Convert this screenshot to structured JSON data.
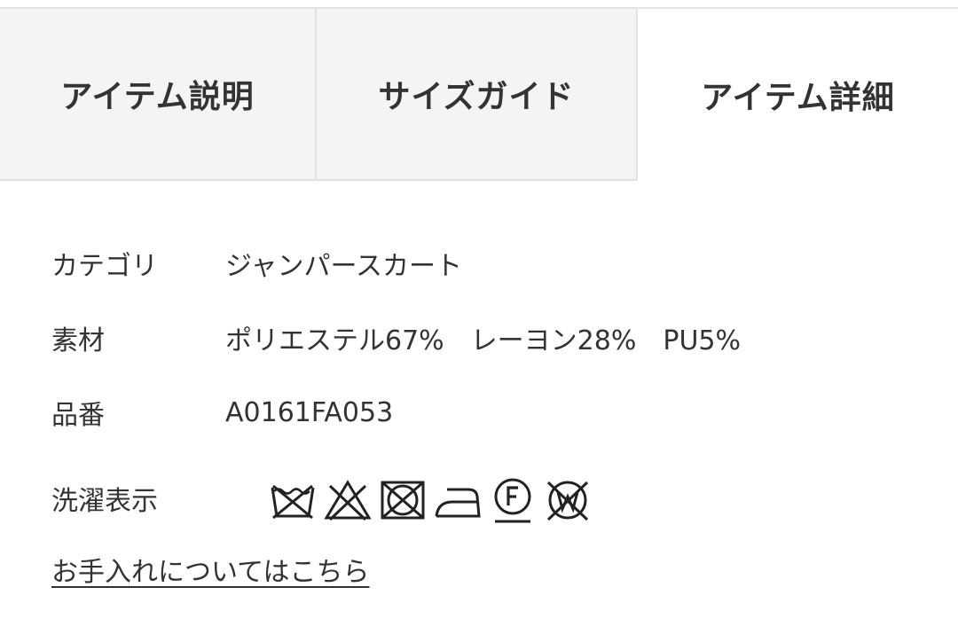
{
  "tabs": [
    {
      "label": "アイテム説明",
      "active": false
    },
    {
      "label": "サイズガイド",
      "active": false
    },
    {
      "label": "アイテム詳細",
      "active": true
    }
  ],
  "details": {
    "category": {
      "label": "カテゴリ",
      "value": "ジャンパースカート"
    },
    "material": {
      "label": "素材",
      "value": "ポリエステル67%　レーヨン28%　PU5%"
    },
    "item_number": {
      "label": "品番",
      "value": "A0161FA053"
    },
    "care": {
      "label": "洗濯表示",
      "icons": [
        "no-wash-icon",
        "no-bleach-icon",
        "no-tumble-dry-icon",
        "iron-low-icon",
        "dry-clean-f-icon",
        "no-wet-clean-icon"
      ]
    }
  },
  "care_link": "お手入れについてはこちら",
  "colors": {
    "text": "#333333",
    "tab_inactive_bg": "#f4f4f4",
    "border": "#e2e2e2"
  }
}
